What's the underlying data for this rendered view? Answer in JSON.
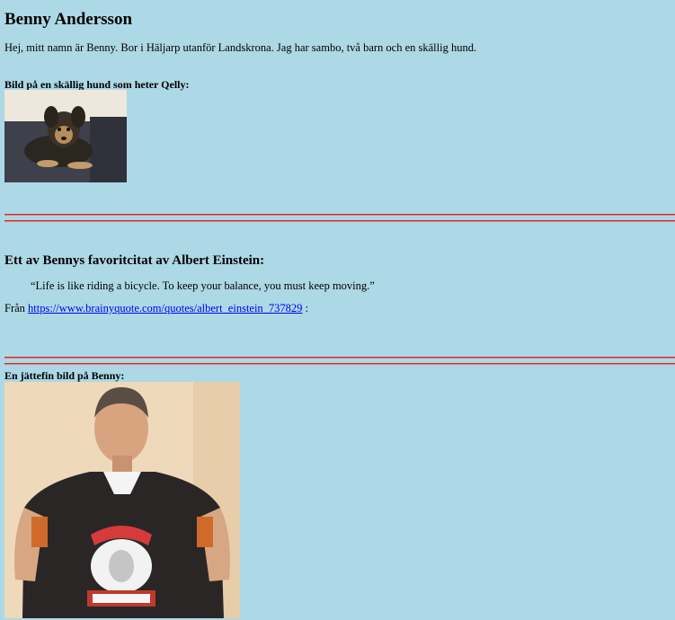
{
  "heading": "Benny Andersson",
  "intro": "Hej, mitt namn är Benny. Bor i Häljarp utanför Landskrona. Jag har sambo, två barn och en skällig hund.",
  "dog": {
    "caption": "Bild på en skällig hund som heter Qelly:"
  },
  "quote_section": {
    "heading": "Ett av Bennys favoritcitat av Albert Einstein:",
    "quote": "“Life is like riding a bicycle. To keep your balance, you must keep moving.”",
    "source_prefix": "Från ",
    "source_link": "https://www.brainyquote.com/quotes/albert_einstein_737829",
    "source_suffix": " :"
  },
  "benny_photo": {
    "caption": "En jättefin bild på Benny:"
  },
  "colors": {
    "background": "#add8e6",
    "rule": "#d12b2b",
    "link": "#0000ee"
  }
}
